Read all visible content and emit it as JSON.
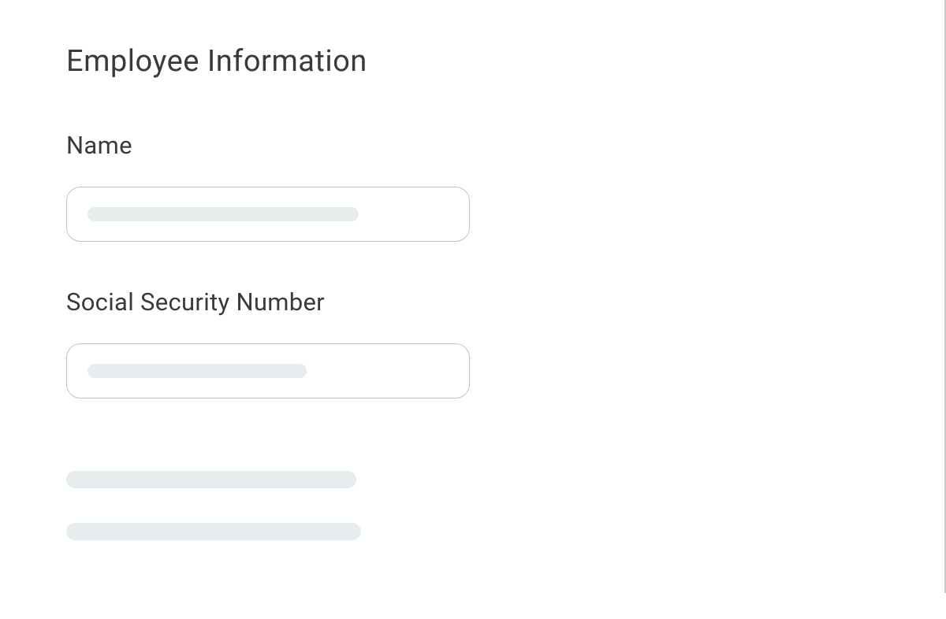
{
  "form": {
    "title": "Employee Information",
    "fields": {
      "name": {
        "label": "Name",
        "value": "",
        "placeholder": ""
      },
      "ssn": {
        "label": "Social Security Number",
        "value": "",
        "placeholder": ""
      }
    }
  }
}
